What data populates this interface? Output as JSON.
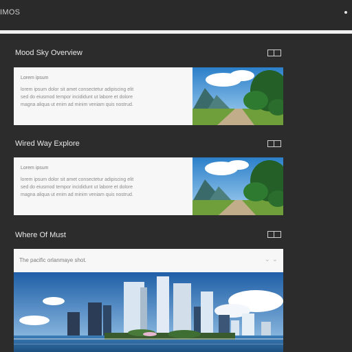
{
  "header": {
    "app_title": "IMOS"
  },
  "sections": [
    {
      "title": "Mood Sky Overview",
      "card": {
        "heading": "Lorem ipsum",
        "lines": [
          "lorem ipsum dolor sit amet consectetur adipiscing elit",
          "sed do eiusmod tempor incididunt ut labore et dolore",
          "magna aliqua ut enim ad minim veniam quis nostrud."
        ]
      }
    },
    {
      "title": "Wired Way Explore",
      "card": {
        "heading": "Lorem ipsum",
        "lines": [
          "lorem ipsum dolor sit amet consectetur adipiscing elit",
          "sed do eiusmod tempor incididunt ut labore et dolore",
          "magna aliqua ut enim ad minim veniam quis nostrud."
        ]
      }
    },
    {
      "title": "Where Of Must",
      "card": {
        "caption": "The pacific orlanmaye shot."
      }
    }
  ]
}
